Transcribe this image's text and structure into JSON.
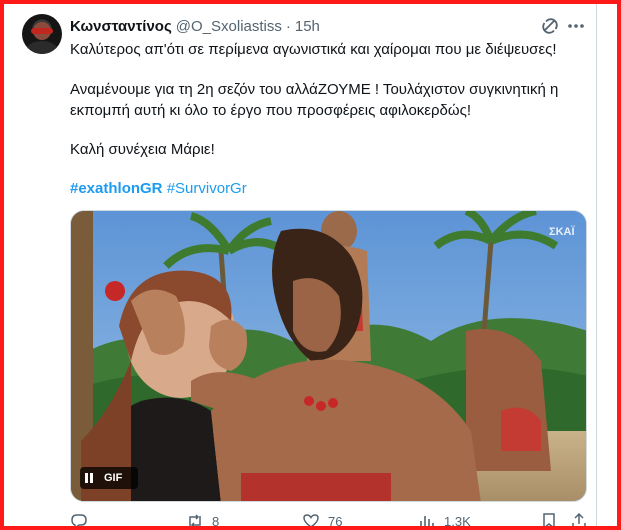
{
  "tweet": {
    "author_name": "Κωνσταντίνος",
    "author_handle": "@O_Sxoliastiss",
    "separator": "·",
    "time": "15h",
    "lines": [
      "Καλύτερος απ'ότι σε περίμενα αγωνιστικά και χαίρομαι που με διέψευσες!",
      "Αναμένουμε για τη 2η σεζόν του αλλάΖΟΥΜΕ ! Τουλάχιστον συγκινητική η εκπομπή αυτή κι όλο το έργο που προσφέρεις αφιλοκερδώς!",
      "Καλή συνέχεια Μάριε!"
    ],
    "hashtags": [
      "#exathlonGR",
      "#SurvivorGr"
    ],
    "media": {
      "badge_label": "GIF",
      "watermark": "ΣΚΑΪ"
    },
    "stats": {
      "replies": "",
      "retweets": "8",
      "likes": "76",
      "views": "1.3K"
    }
  },
  "colors": {
    "accent": "#1d9bf0",
    "muted": "#536471",
    "frame": "#ff1a1a"
  },
  "icons": [
    "grok-icon",
    "more-icon",
    "pause-icon",
    "reply-icon",
    "retweet-icon",
    "like-icon",
    "views-icon",
    "bookmark-icon",
    "share-icon"
  ]
}
